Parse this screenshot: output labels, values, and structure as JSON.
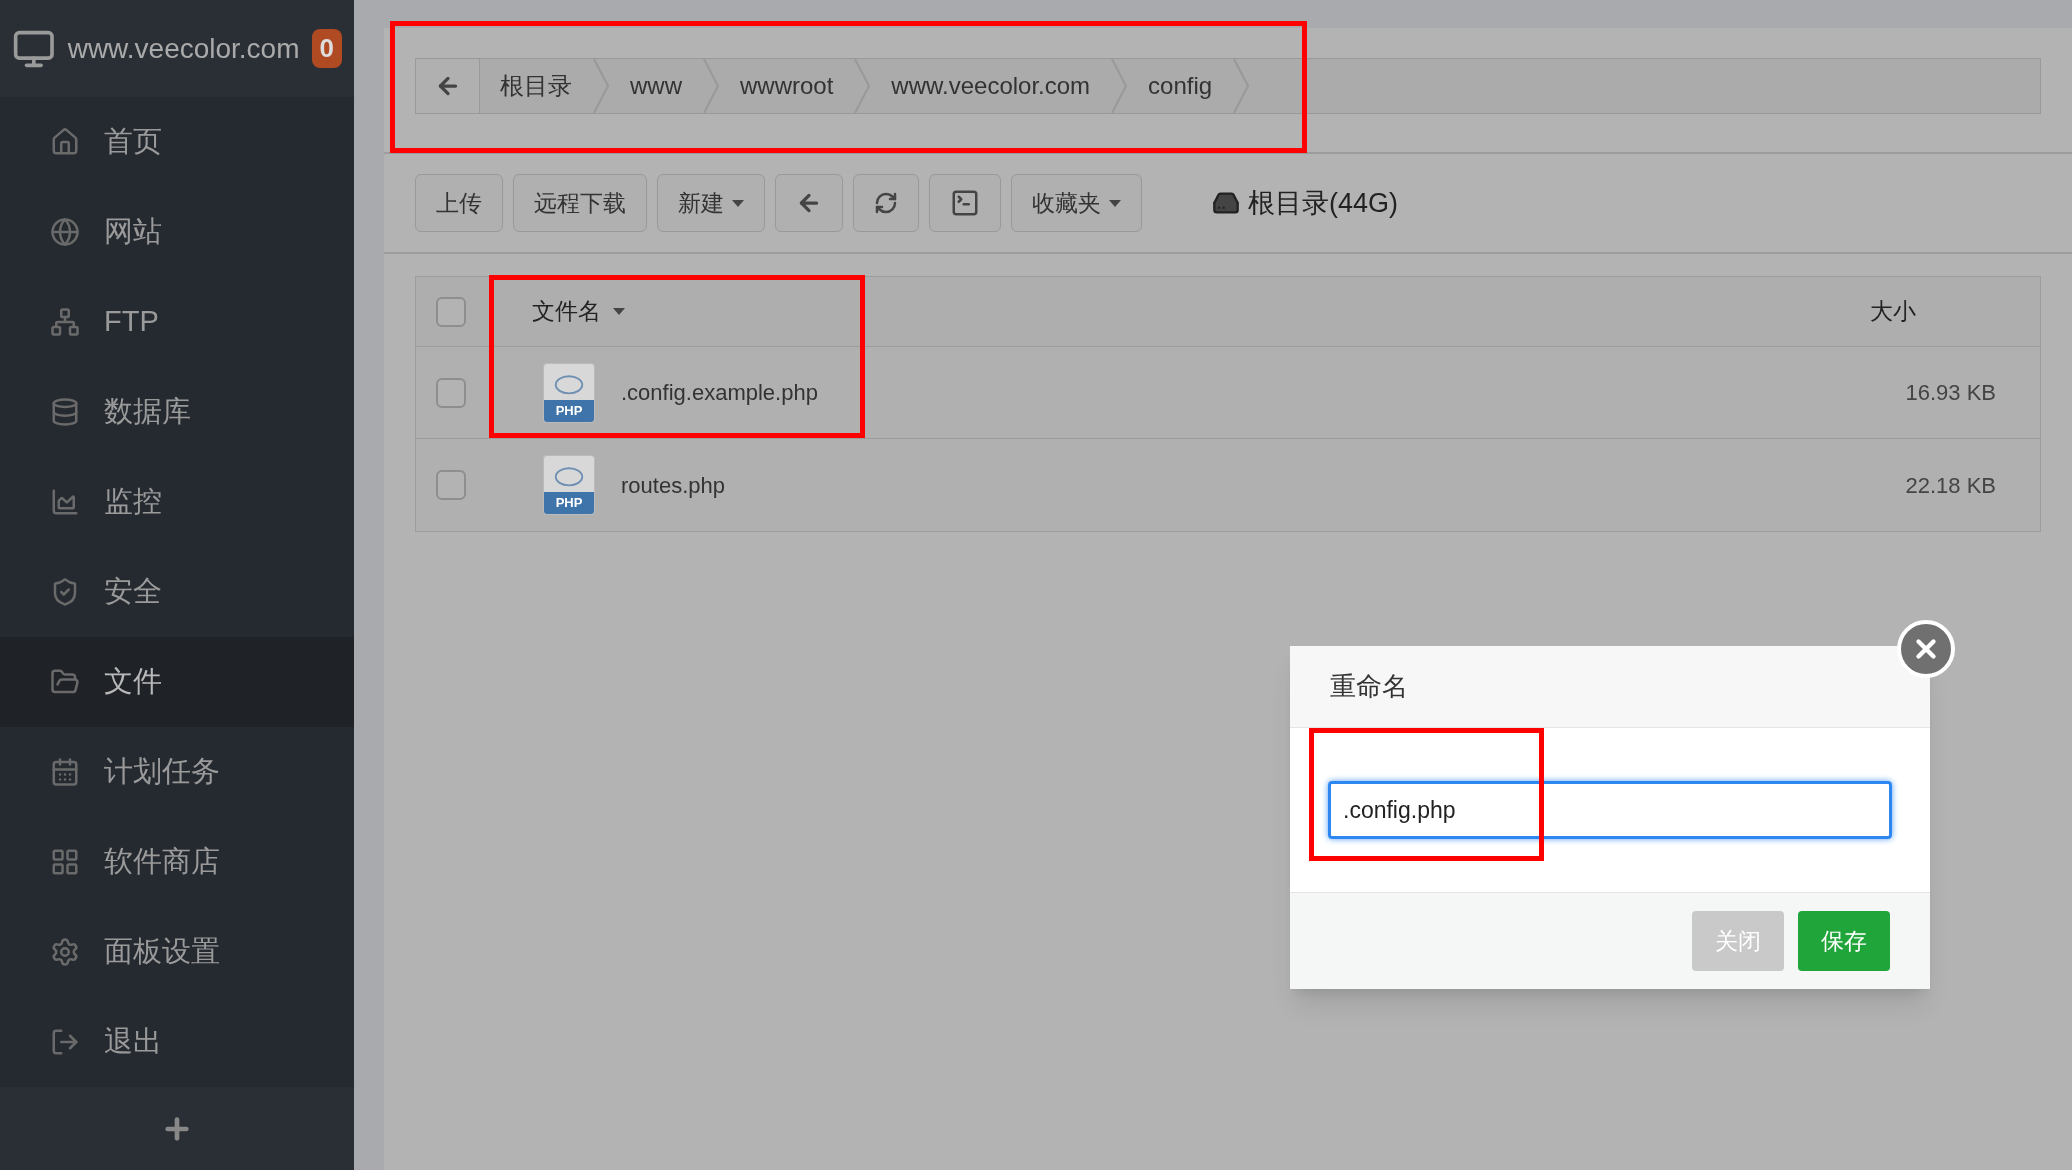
{
  "sidebar": {
    "site": "www.veecolor.com",
    "badge": "0",
    "items": [
      {
        "label": "首页",
        "selected": false
      },
      {
        "label": "网站",
        "selected": false
      },
      {
        "label": "FTP",
        "selected": false
      },
      {
        "label": "数据库",
        "selected": false
      },
      {
        "label": "监控",
        "selected": false
      },
      {
        "label": "安全",
        "selected": false
      },
      {
        "label": "文件",
        "selected": true
      },
      {
        "label": "计划任务",
        "selected": false
      },
      {
        "label": "软件商店",
        "selected": false
      },
      {
        "label": "面板设置",
        "selected": false
      },
      {
        "label": "退出",
        "selected": false
      }
    ]
  },
  "breadcrumb": [
    "根目录",
    "www",
    "wwwroot",
    "www.veecolor.com",
    "config"
  ],
  "toolbar": {
    "buttons": [
      {
        "kind": "text",
        "label": "上传"
      },
      {
        "kind": "text",
        "label": "远程下载"
      },
      {
        "kind": "dropdown",
        "label": "新建"
      },
      {
        "kind": "back"
      },
      {
        "kind": "refresh"
      },
      {
        "kind": "terminal"
      },
      {
        "kind": "dropdown",
        "label": "收藏夹"
      }
    ],
    "disk": "根目录(44G)"
  },
  "table": {
    "columns": [
      "文件名",
      "大小"
    ],
    "header_checked": false,
    "rows": [
      {
        "name": ".config.example.php",
        "type": "PHP",
        "size": "16.93 KB",
        "checked": false
      },
      {
        "name": "routes.php",
        "type": "PHP",
        "size": "22.18 KB",
        "checked": false
      }
    ]
  },
  "dialog": {
    "title": "重命名",
    "value": ".config.php",
    "buttons": [
      {
        "kind": "secondary",
        "label": "关闭"
      },
      {
        "kind": "primary",
        "label": "保存"
      }
    ]
  }
}
